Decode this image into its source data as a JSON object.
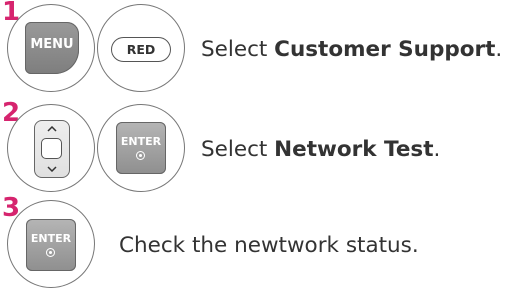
{
  "steps": [
    {
      "number": "1",
      "buttons": [
        "MENU",
        "RED"
      ],
      "text_prefix": "Select ",
      "text_bold": "Customer Support",
      "text_suffix": "."
    },
    {
      "number": "2",
      "buttons": [
        "ENTER"
      ],
      "text_prefix": "Select ",
      "text_bold": "Network Test",
      "text_suffix": "."
    },
    {
      "number": "3",
      "buttons": [
        "ENTER"
      ],
      "text_prefix": "Check the newtwork status.",
      "text_bold": "",
      "text_suffix": ""
    }
  ],
  "colors": {
    "step_number": "#d6246e",
    "text": "#333333"
  },
  "icons": {
    "nav_up": "▲",
    "nav_down": "▼"
  }
}
